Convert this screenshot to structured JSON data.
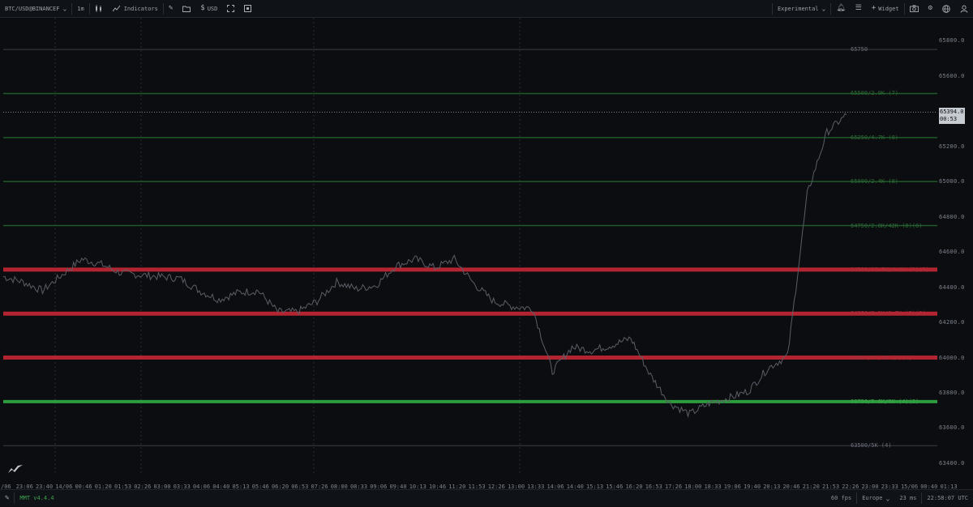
{
  "toolbar": {
    "symbol": "BTC/USD@BINANCEF",
    "timeframe": "1m",
    "indicators_label": "Indicators",
    "currency_label": "USD",
    "preset_label": "Experimental",
    "widget_label": "Widget"
  },
  "icons": {
    "chevron": "chevron-down-icon",
    "candles": "candlestick-chart-icon",
    "indicators": "line-chart-icon",
    "draw": "pencil-icon",
    "folder": "folder-icon",
    "dollar": "dollar-icon",
    "fullscreen": "fullscreen-icon",
    "screenshot_box": "square-icon",
    "bell": "bell-icon",
    "list": "list-icon",
    "plus": "plus-icon",
    "camera": "camera-icon",
    "settings": "gear-icon",
    "globe": "globe-icon",
    "user": "user-icon"
  },
  "colors": {
    "background": "#0b0d11",
    "bid_level": "#2d9c3c",
    "ask_level": "#b32431",
    "weak_green": "#1f5a28",
    "price_line": "#5a5e66"
  },
  "chart_data": {
    "type": "line",
    "series": [
      {
        "x": [
          "23:06",
          "23:40",
          "00:13",
          "00:46",
          "01:20",
          "01:53",
          "02:26",
          "03:00",
          "03:33",
          "04:06",
          "04:40",
          "05:13",
          "05:46",
          "06:20",
          "06:53",
          "07:26",
          "08:00",
          "08:33",
          "09:06",
          "09:40",
          "10:13",
          "10:46",
          "11:20",
          "11:53",
          "12:26",
          "13:00",
          "13:33",
          "14:06",
          "14:40",
          "15:13",
          "15:46",
          "16:20",
          "16:53",
          "17:26",
          "18:00",
          "18:33",
          "19:06",
          "19:40",
          "20:13",
          "20:46",
          "21:20",
          "21:53",
          "22:26",
          "23:00"
        ],
        "values": [
          64460,
          64430,
          64380,
          64470,
          64560,
          64530,
          64480,
          64470,
          64460,
          64450,
          64380,
          64330,
          64370,
          64380,
          64260,
          64260,
          64320,
          64430,
          64390,
          64410,
          64520,
          64560,
          64510,
          64560,
          64420,
          64320,
          64290,
          64280,
          63920,
          64060,
          64040,
          64070,
          64110,
          63900,
          63740,
          63680,
          63740,
          63770,
          63810,
          63940,
          64010,
          64930,
          65280,
          65380
        ]
      }
    ],
    "ylim": [
      63340,
      65930
    ],
    "yticks": [
      "65800.0",
      "65600.0",
      "65400.0",
      "65200.0",
      "65000.0",
      "64800.0",
      "64600.0",
      "64400.0",
      "64200.0",
      "64000.0",
      "63800.0",
      "63600.0",
      "63400.0"
    ],
    "xticks": [
      "/06",
      "23:06",
      "23:40",
      "14/06",
      "00:46",
      "01:20",
      "01:53",
      "02:26",
      "03:00",
      "03:33",
      "04:06",
      "04:40",
      "05:13",
      "05:46",
      "06:20",
      "06:53",
      "07:26",
      "08:00",
      "08:33",
      "09:06",
      "09:40",
      "10:13",
      "10:46",
      "11:20",
      "11:53",
      "12:26",
      "13:00",
      "13:33",
      "14:06",
      "14:40",
      "15:13",
      "15:46",
      "16:20",
      "16:53",
      "17:26",
      "18:00",
      "18:33",
      "19:06",
      "19:40",
      "20:13",
      "20:46",
      "21:20",
      "21:53",
      "22:26",
      "23:00",
      "23:33",
      "15/06",
      "00:40",
      "01:13"
    ],
    "current_price": "65394.0",
    "countdown": "00:53",
    "levels": [
      {
        "price": 65750,
        "label": "65750",
        "kind": "thin-gray"
      },
      {
        "price": 65500,
        "label": "65500/2.9K (7)",
        "kind": "weak-green"
      },
      {
        "price": 65250,
        "label": "65250/4.7K (8)",
        "kind": "weak-green"
      },
      {
        "price": 65000,
        "label": "65000/2.4K (8)",
        "kind": "weak-green"
      },
      {
        "price": 64750,
        "label": "64750/2.8K/42K (8)(6)",
        "kind": "weak-green"
      },
      {
        "price": 64500,
        "label": "64500/12.3K/4.4K (1)(5)",
        "kind": "ask"
      },
      {
        "price": 64250,
        "label": "64250/8.1K/8.7K (2)(3)",
        "kind": "ask"
      },
      {
        "price": 64000,
        "label": "64000/7K/9K (3)(1)",
        "kind": "ask"
      },
      {
        "price": 63750,
        "label": "63750/5.6K/9K (4)(2)",
        "kind": "bid"
      },
      {
        "price": 63500,
        "label": "63500/5K (4)",
        "kind": "thin-gray"
      }
    ],
    "grid": false,
    "legend": "none"
  },
  "status": {
    "version": "MMT v4.4.4",
    "fps": "60 fps",
    "region": "Europe",
    "latency": "23 ms",
    "clock": "22:58:07 UTC"
  }
}
